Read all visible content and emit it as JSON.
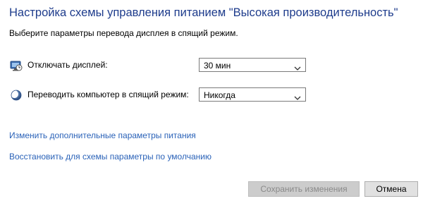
{
  "header": {
    "title": "Настройка схемы управления питанием \"Высокая производительность\"",
    "subtitle": "Выберите параметры перевода дисплея в спящий режим."
  },
  "settings": {
    "display_off": {
      "icon": "monitor-clock-icon",
      "label": "Отключать дисплей:",
      "selected_value": "30 мин"
    },
    "sleep": {
      "icon": "moon-sleep-icon",
      "label": "Переводить компьютер в спящий режим:",
      "selected_value": "Никогда"
    }
  },
  "links": {
    "advanced": "Изменить дополнительные параметры питания",
    "restore_defaults": "Восстановить для схемы параметры по умолчанию"
  },
  "buttons": {
    "save_label": "Сохранить изменения",
    "save_enabled": false,
    "cancel_label": "Отмена"
  },
  "colors": {
    "title": "#1e3c8c",
    "link": "#2a62b8",
    "disabled_button_bg": "#cccccc",
    "disabled_button_text": "#8a8a8a"
  }
}
